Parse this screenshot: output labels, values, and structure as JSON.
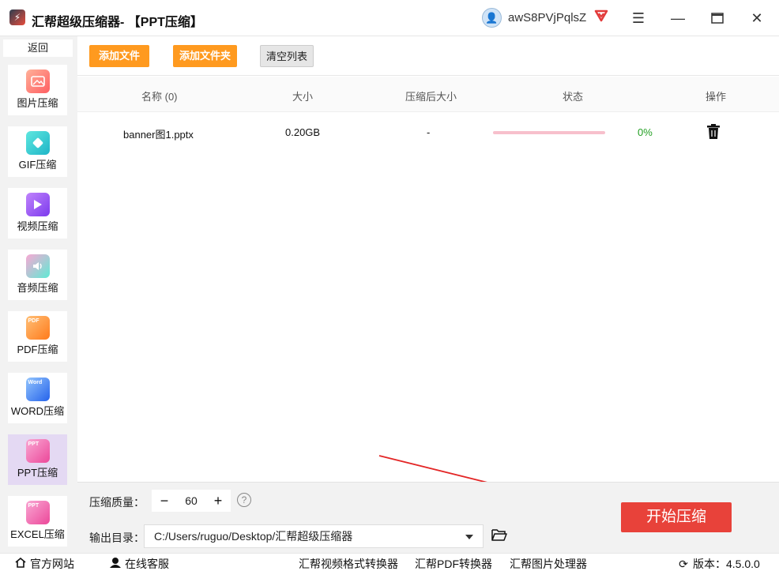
{
  "window": {
    "app_name": "汇帮超级压缩器",
    "separator": "-",
    "section": "【PPT压缩】",
    "username": "awS8PVjPqlsZ"
  },
  "sidebar": {
    "back_label": "返回",
    "items": [
      {
        "label": "图片压缩",
        "icon": "image-icon",
        "color": "#ff6f61"
      },
      {
        "label": "GIF压缩",
        "icon": "gif-icon",
        "color": "#25c6c8"
      },
      {
        "label": "视频压缩",
        "icon": "video-icon",
        "color": "#9b59e8"
      },
      {
        "label": "音频压缩",
        "icon": "audio-icon",
        "color": "#39c6b7"
      },
      {
        "label": "PDF压缩",
        "icon": "pdf-icon",
        "color": "#ff8a2a"
      },
      {
        "label": "WORD压缩",
        "icon": "word-icon",
        "color": "#3a9af2"
      },
      {
        "label": "PPT压缩",
        "icon": "ppt-icon",
        "color": "#f25fa8"
      },
      {
        "label": "EXCEL压缩",
        "icon": "excel-icon",
        "color": "#f25fa8"
      }
    ],
    "icon_badges": [
      "PDF",
      "Word",
      "PPT",
      "PPT"
    ]
  },
  "toolbar": {
    "add_file": "添加文件",
    "add_folder": "添加文件夹",
    "clear_list": "清空列表"
  },
  "table": {
    "headers": {
      "name": "名称 (0)",
      "size": "大小",
      "compressed_size": "压缩后大小",
      "status": "状态",
      "action": "操作"
    },
    "rows": [
      {
        "name": "banner图1.pptx",
        "size": "0.20GB",
        "compressed_size": "-",
        "progress": "0%"
      }
    ]
  },
  "settings": {
    "quality_label": "压缩质量：",
    "quality_value": "60",
    "output_label": "输出目录：",
    "output_path": "C:/Users/ruguo/Desktop/汇帮超级压缩器",
    "start_button": "开始压缩"
  },
  "footer": {
    "website": "官方网站",
    "support": "在线客服",
    "links": [
      "汇帮视频格式转换器",
      "汇帮PDF转换器",
      "汇帮图片处理器"
    ],
    "version": "版本：4.5.0.0"
  },
  "colors": {
    "accent_orange": "#ff9a1f",
    "start_red": "#e8423a",
    "progress_pink": "#f7c0cc",
    "progress_text_green": "#24a024",
    "sidebar_active": "#e4d9f3"
  }
}
